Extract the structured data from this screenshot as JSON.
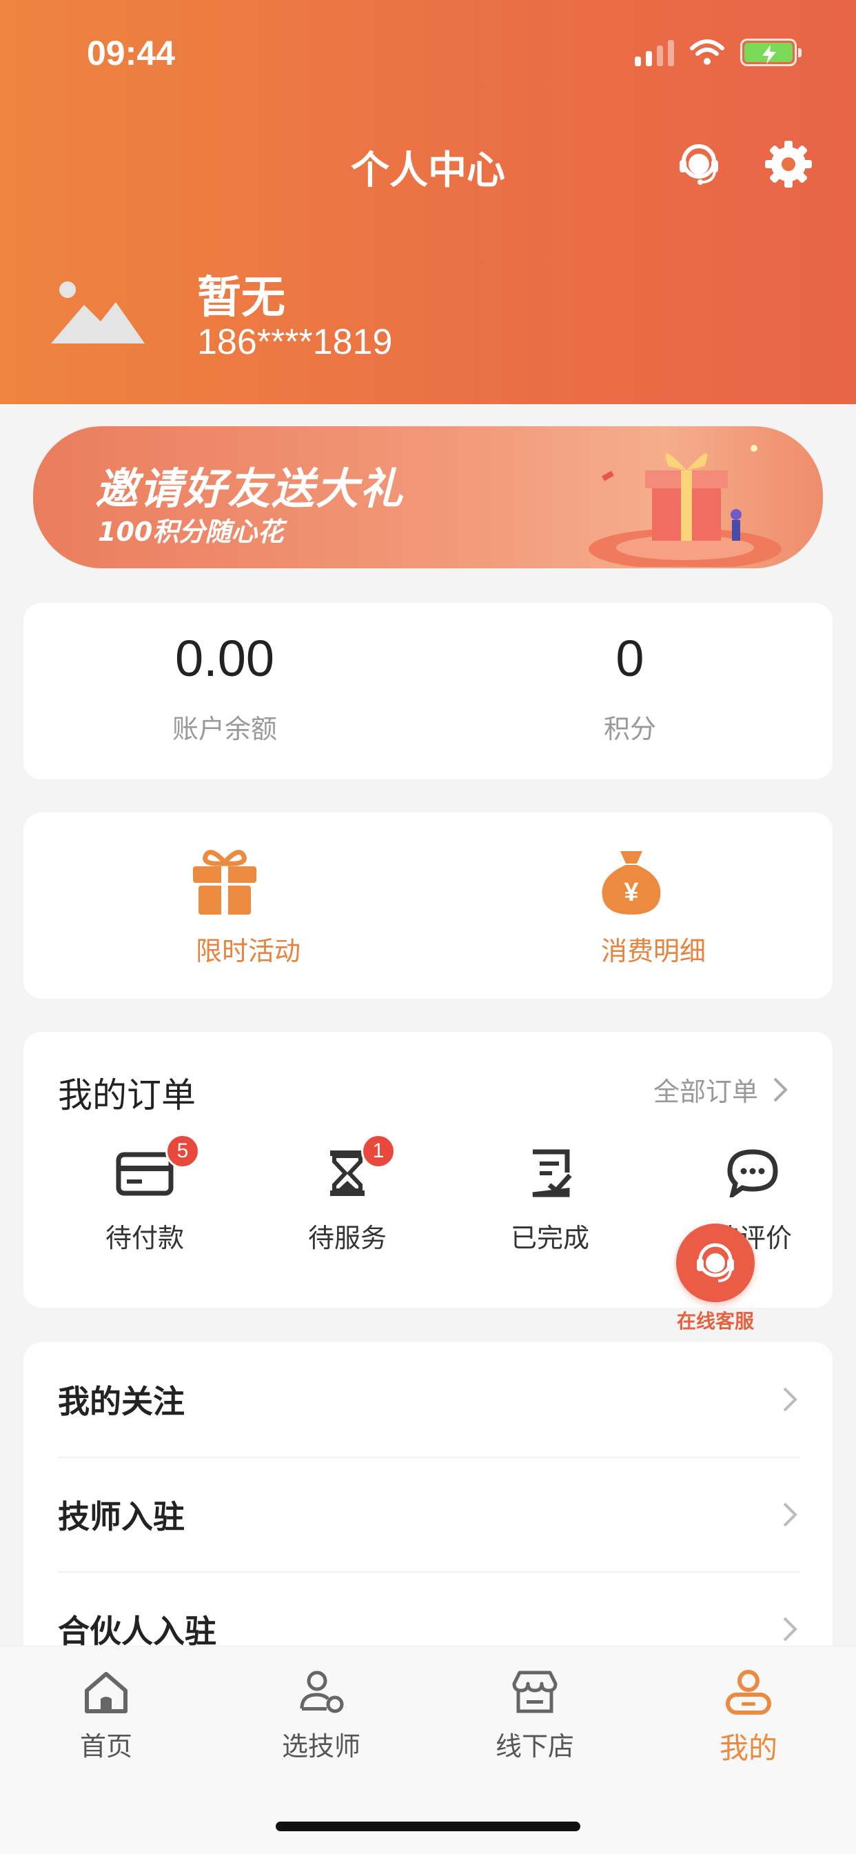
{
  "status_bar": {
    "time": "09:44"
  },
  "header": {
    "title": "个人中心",
    "icons": [
      "headset-icon",
      "gear-icon"
    ]
  },
  "profile": {
    "name": "暂无",
    "phone": "186****1819"
  },
  "banner": {
    "title": "邀请好友送大礼",
    "subtitle": "100积分随心花"
  },
  "stats": {
    "balance": {
      "value": "0.00",
      "label": "账户余额"
    },
    "points": {
      "value": "0",
      "label": "积分"
    }
  },
  "quick_actions": [
    {
      "label": "限时活动",
      "icon": "gift-icon"
    },
    {
      "label": "消费明细",
      "icon": "money-bag-icon"
    }
  ],
  "orders": {
    "title": "我的订单",
    "all_link": "全部订单",
    "items": [
      {
        "label": "待付款",
        "badge": "5",
        "icon": "card-icon"
      },
      {
        "label": "待服务",
        "badge": "1",
        "icon": "hourglass-icon"
      },
      {
        "label": "已完成",
        "icon": "checklist-icon"
      },
      {
        "label": "待评价",
        "icon": "chat-icon"
      }
    ]
  },
  "menu": [
    {
      "label": "我的关注"
    },
    {
      "label": "技师入驻"
    },
    {
      "label": "合伙人入驻"
    }
  ],
  "floating_service": {
    "label": "在线客服"
  },
  "tabbar": [
    {
      "label": "首页",
      "icon": "home-icon",
      "active": false
    },
    {
      "label": "选技师",
      "icon": "technician-icon",
      "active": false
    },
    {
      "label": "线下店",
      "icon": "store-icon",
      "active": false
    },
    {
      "label": "我的",
      "icon": "profile-icon",
      "active": true
    }
  ],
  "colors": {
    "accent": "#ec8a3f",
    "header_start": "#ee8440",
    "header_end": "#e86548",
    "badge": "#e8493c"
  }
}
